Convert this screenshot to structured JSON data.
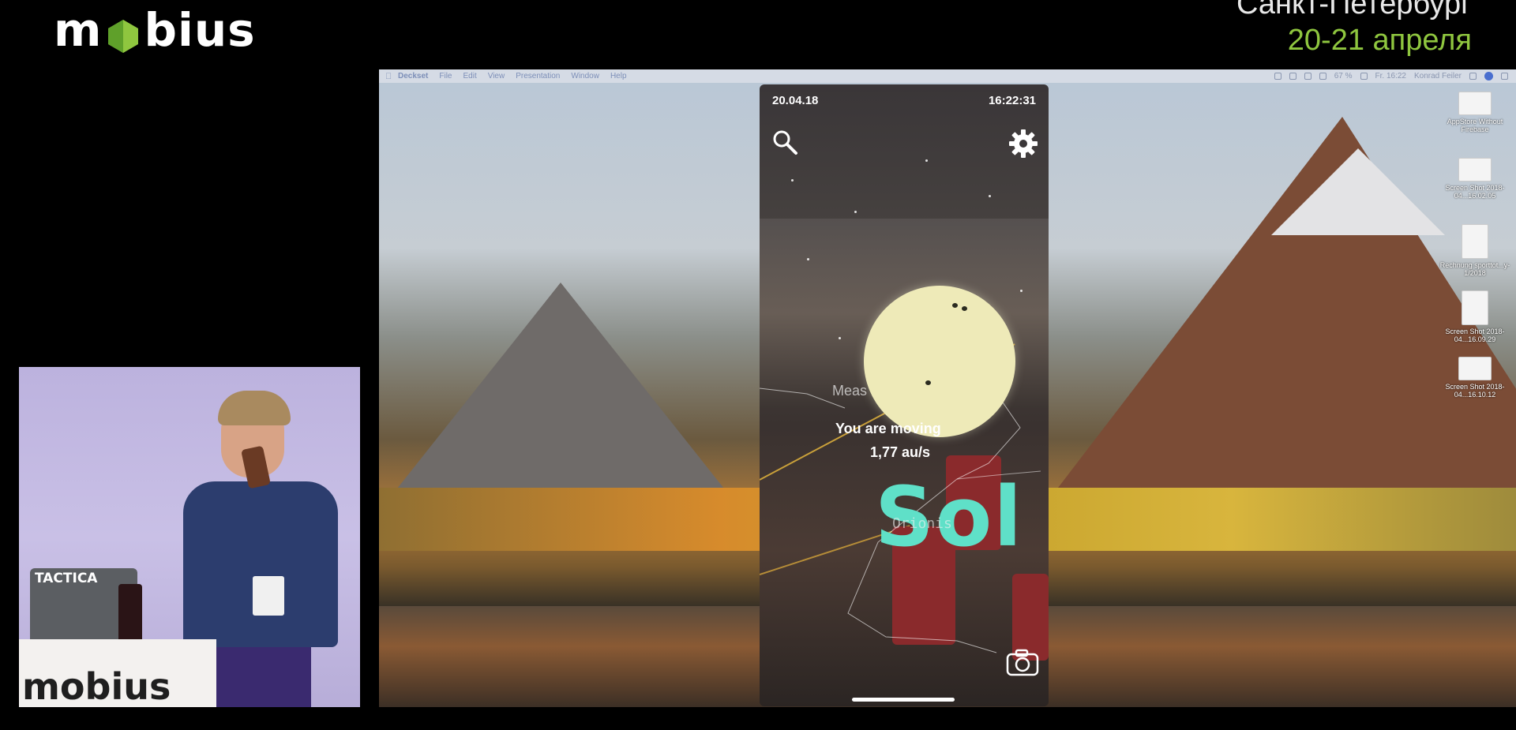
{
  "branding": {
    "logo_left": "m",
    "logo_right": "bius",
    "event_city": "Санкт-Петербург",
    "event_date": "20-21 апреля",
    "accent_color": "#8fc63f"
  },
  "speaker_cam": {
    "podium_logo": "mobius",
    "laptop_sticker": "TACTICA"
  },
  "menubar": {
    "app_name": "Deckset",
    "menus": [
      "File",
      "Edit",
      "View",
      "Presentation",
      "Window",
      "Help"
    ],
    "battery": "67 %",
    "clock": "Fr. 16:22",
    "user": "Konrad Feiler"
  },
  "desktop_icons": [
    {
      "label": "AppStore Without Firebase",
      "icon": "document-icon"
    },
    {
      "label": "Screen Shot 2018-04...16.02.05",
      "icon": "screenshot-icon"
    },
    {
      "label": "Rechnung sporttot...y-1/2018",
      "icon": "pdf-icon"
    },
    {
      "label": "Screen Shot 2018-04...16.09.29",
      "icon": "screenshot-icon"
    },
    {
      "label": "Screen Shot 2018-04...16.10.12",
      "icon": "screenshot-icon"
    }
  ],
  "phone": {
    "date": "20.04.18",
    "time": "16:22:31",
    "measure_label": "Meas",
    "you_are_label": "You are moving",
    "speed": "1,77 au/s",
    "star_name": "Sol",
    "constellation": "Orionis",
    "star_color": "#5fe0c8",
    "sun_color": "#eeeab8"
  }
}
